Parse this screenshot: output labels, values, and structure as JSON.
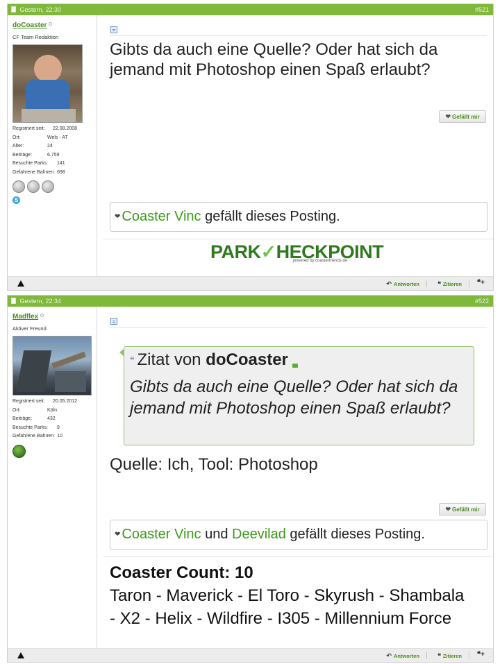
{
  "posts": [
    {
      "date": "Gestern, 22:30",
      "number": "#521",
      "user": {
        "name": "doCoaster",
        "title": "CF Team Redaktion",
        "stats": [
          {
            "label": "Registriert seit:",
            "value": "22.08.2008"
          },
          {
            "label": "Ort:",
            "value": "Wels - AT"
          },
          {
            "label": "Alter:",
            "value": "24"
          },
          {
            "label": "Beiträge:",
            "value": "6.759"
          },
          {
            "label": "Besuchte Parks:",
            "value": "141"
          },
          {
            "label": "Gefahrene Bahnen:",
            "value": "698"
          }
        ]
      },
      "message": "Gibts da auch eine Quelle? Oder hat sich da jemand mit Photoshop einen Spaß erlaubt?",
      "like_button": "Gefällt mir",
      "likes": {
        "users": [
          "Coaster Vinc"
        ],
        "joiner": "",
        "suffix": "gefällt dieses Posting."
      },
      "signature": {
        "logo_part1": "PARK",
        "logo_check": "✓",
        "logo_part2": "HECKPOINT",
        "logo_sub": "powered by coasterfriends.de"
      }
    },
    {
      "date": "Gestern, 22:34",
      "number": "#522",
      "user": {
        "name": "Madflex",
        "title": "Aktiver Freund",
        "stats": [
          {
            "label": "Registriert seit:",
            "value": "20.05.2012"
          },
          {
            "label": "Ort:",
            "value": "Köln"
          },
          {
            "label": "Beiträge:",
            "value": "432"
          },
          {
            "label": "Besuchte Parks:",
            "value": "9"
          },
          {
            "label": "Gefahrene Bahnen:",
            "value": "10"
          }
        ]
      },
      "quote": {
        "prefix": "Zitat von",
        "author": "doCoaster",
        "text": "Gibts da auch eine Quelle? Oder hat sich da jemand mit Photoshop einen Spaß erlaubt?"
      },
      "message": "Quelle: Ich, Tool: Photoshop",
      "like_button": "Gefällt mir",
      "likes": {
        "users": [
          "Coaster Vinc",
          "Deevilad"
        ],
        "joiner": "und",
        "suffix": "gefällt dieses Posting."
      },
      "signature": {
        "count_title": "Coaster Count: 10",
        "count_list": "Taron - Maverick - El Toro - Skyrush - Shambala - X2 - Helix - Wildfire - I305 - Millennium Force"
      }
    }
  ],
  "footer": {
    "reply": "Antworten",
    "quote": "Zitieren"
  },
  "icons": {
    "warning": "warning-icon",
    "reply": "reply-icon",
    "quote": "quote-icon",
    "multiquote": "multiquote-icon",
    "heart": "heart-icon"
  },
  "colors": {
    "header_green": "#7fb83a",
    "link_green": "#3c9a1a"
  }
}
